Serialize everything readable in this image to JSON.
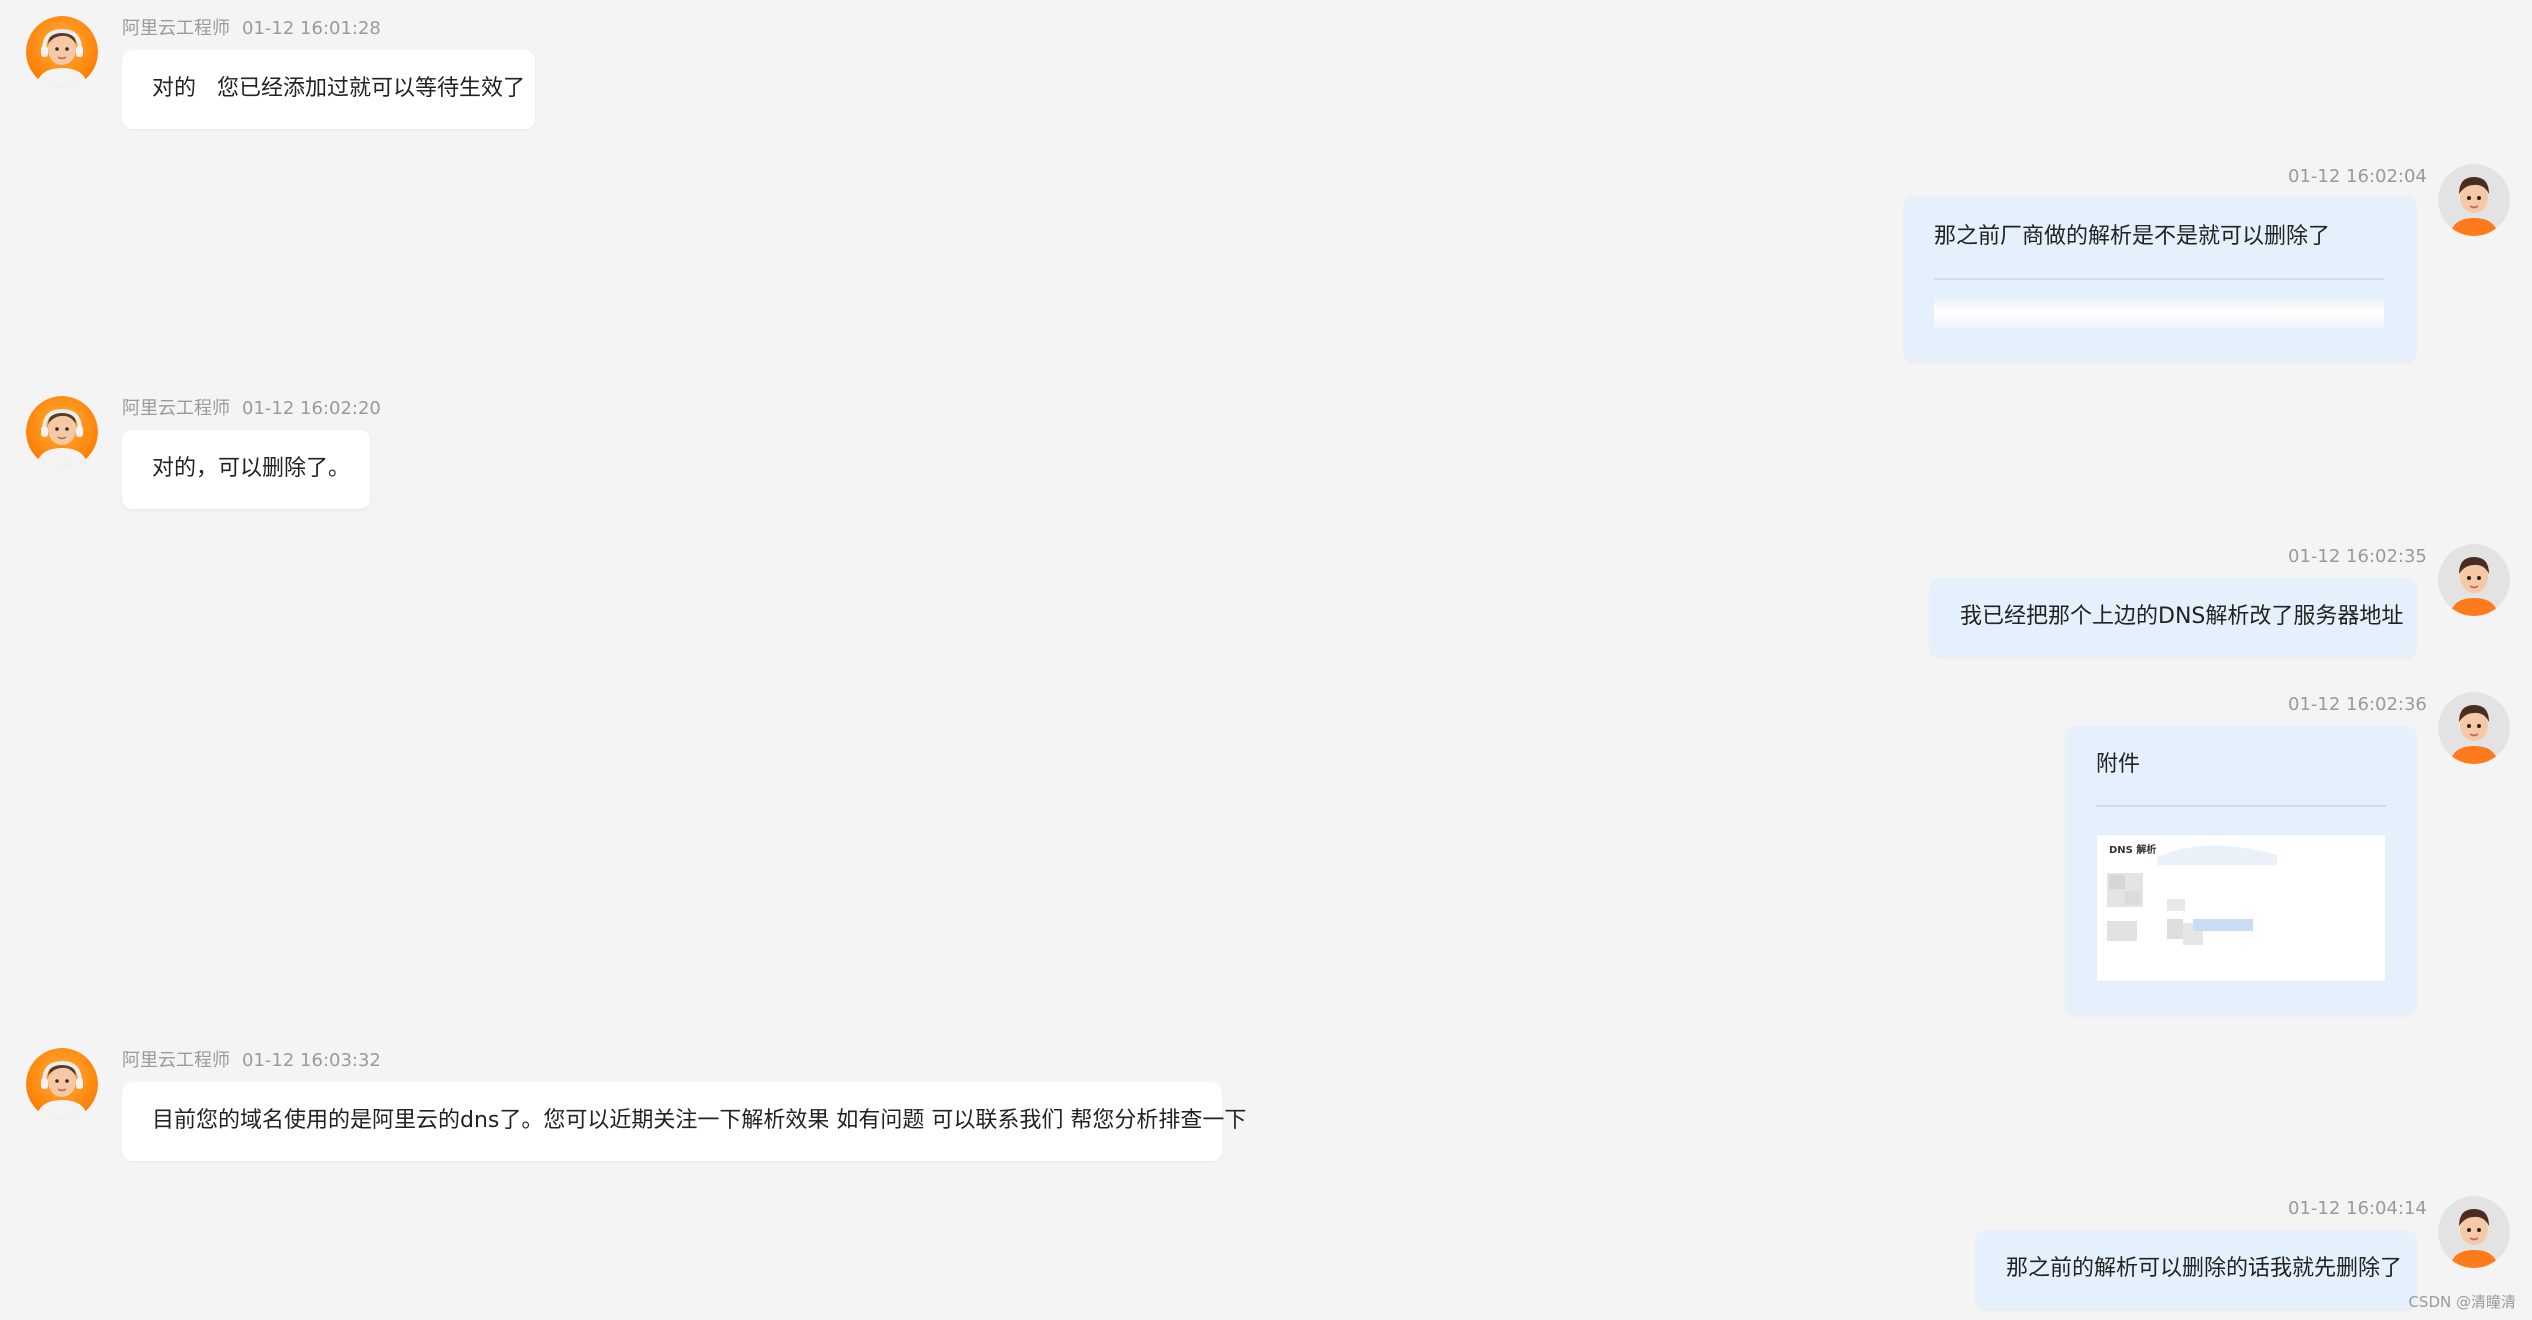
{
  "messages": [
    {
      "side": "agent",
      "sender": "阿里云工程师",
      "time": "01-12 16:01:28",
      "text": "对的   您已经添加过就可以等待生效了"
    },
    {
      "side": "user",
      "time": "01-12 16:02:04",
      "text": "那之前厂商做的解析是不是就可以删除了",
      "has_blurred_attachment": true
    },
    {
      "side": "agent",
      "sender": "阿里云工程师",
      "time": "01-12 16:02:20",
      "text": "对的，可以删除了。"
    },
    {
      "side": "user",
      "time": "01-12 16:02:35",
      "text": "我已经把那个上边的DNS解析改了服务器地址"
    },
    {
      "side": "user",
      "time": "01-12 16:02:36",
      "text": "附件",
      "attachment_title": "DNS 解析"
    },
    {
      "side": "agent",
      "sender": "阿里云工程师",
      "time": "01-12 16:03:32",
      "text": "目前您的域名使用的是阿里云的dns了。您可以近期关注一下解析效果 如有问题 可以联系我们 帮您分析排查一下"
    },
    {
      "side": "user",
      "time": "01-12 16:04:14",
      "text": "那之前的解析可以删除的话我就先删除了"
    }
  ],
  "watermark": "CSDN @清瞳清",
  "colors": {
    "background": "#f4f4f4",
    "agent_bubble": "#ffffff",
    "user_bubble": "#e4f1fd",
    "meta_text": "#9a9a9a",
    "agent_avatar_bg": "#ff8a00",
    "user_avatar_bg": "#e3e3e3",
    "user_shirt": "#ff7a1a"
  },
  "icons": {
    "agent_avatar": "support-engineer-headset-avatar",
    "user_avatar": "user-3d-avatar"
  }
}
